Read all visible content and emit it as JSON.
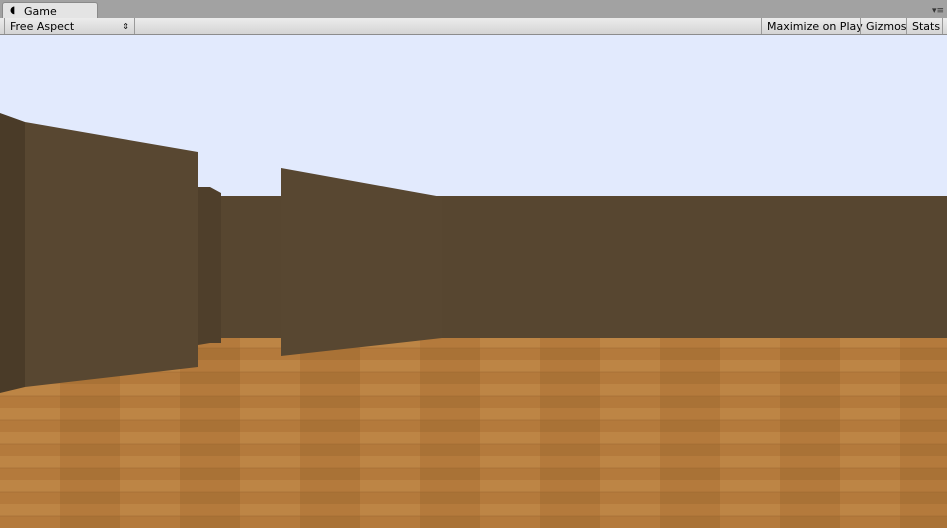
{
  "tab": {
    "title": "Game",
    "icon": "pacman-game-icon"
  },
  "toolbar": {
    "aspect": "Free Aspect",
    "maximize": "Maximize on Play",
    "gizmos": "Gizmos",
    "stats": "Stats"
  },
  "colors": {
    "sky": "#e2eafd",
    "floor": "#b47a3c",
    "wall": "#574630"
  }
}
